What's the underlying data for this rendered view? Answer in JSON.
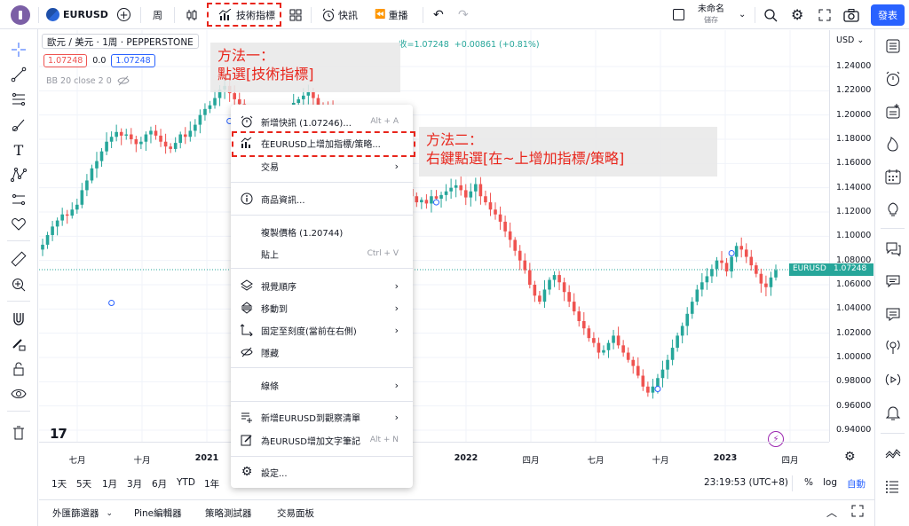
{
  "topbar": {
    "symbol": "EURUSD",
    "interval": "周",
    "indicators_label": "技術指標",
    "alert_label": "快訊",
    "replay_label": "重播",
    "layout_name": "未命名",
    "layout_sub": "儲存",
    "publish_label": "發表"
  },
  "legend": {
    "title": "歐元 / 美元 · 1周 · PEPPERSTONE",
    "ohlc_tail": "收=1.07248",
    "change": "+0.00861 (+0.81%)",
    "bid": "1.07248",
    "spread": "0.0",
    "ask": "1.07248",
    "indicator": "BB 20 close 2 0"
  },
  "price_axis": {
    "currency": "USD",
    "ticks": [
      "1.24000",
      "1.22000",
      "1.20000",
      "1.18000",
      "1.16000",
      "1.14000",
      "1.12000",
      "1.10000",
      "1.08000",
      "1.06000",
      "1.04000",
      "1.02000",
      "1.00000",
      "0.98000",
      "0.96000",
      "0.94000"
    ],
    "last_symbol": "EURUSD",
    "last_price": "1.07248"
  },
  "time_axis": {
    "ticks": [
      "七月",
      "十月",
      "2021",
      "2022",
      "四月",
      "七月",
      "十月",
      "2023",
      "四月"
    ]
  },
  "chart_data": {
    "type": "candlestick",
    "title": "歐元 / 美元 · 1周 · PEPPERSTONE",
    "ylim": [
      0.93,
      1.25
    ],
    "series_name": "EURUSD",
    "last": 1.07248,
    "close_path": [
      1.093,
      1.101,
      1.108,
      1.113,
      1.118,
      1.117,
      1.122,
      1.126,
      1.138,
      1.146,
      1.156,
      1.162,
      1.17,
      1.178,
      1.182,
      1.186,
      1.183,
      1.184,
      1.18,
      1.176,
      1.178,
      1.184,
      1.187,
      1.183,
      1.178,
      1.174,
      1.172,
      1.177,
      1.184,
      1.182,
      1.187,
      1.192,
      1.2,
      1.205,
      1.208,
      1.214,
      1.221,
      1.224,
      1.218,
      1.213,
      1.209,
      1.205,
      1.198,
      1.193,
      1.184,
      1.178,
      1.172,
      1.178,
      1.186,
      1.196,
      1.204,
      1.21,
      1.213,
      1.216,
      1.219,
      1.214,
      1.208,
      1.206,
      1.205,
      1.198,
      1.192,
      1.188,
      1.185,
      1.183,
      1.18,
      1.178,
      1.175,
      1.171,
      1.165,
      1.16,
      1.158,
      1.155,
      1.15,
      1.146,
      1.139,
      1.133,
      1.128,
      1.13,
      1.127,
      1.133,
      1.131,
      1.134,
      1.137,
      1.14,
      1.142,
      1.138,
      1.132,
      1.137,
      1.143,
      1.133,
      1.128,
      1.122,
      1.118,
      1.112,
      1.104,
      1.097,
      1.088,
      1.08,
      1.072,
      1.06,
      1.051,
      1.046,
      1.056,
      1.064,
      1.068,
      1.062,
      1.054,
      1.046,
      1.038,
      1.03,
      1.024,
      1.016,
      1.012,
      1.004,
      1.006,
      1.012,
      1.018,
      1.01,
      1.004,
      0.998,
      0.993,
      0.985,
      0.976,
      0.971,
      0.976,
      0.983,
      0.99,
      0.998,
      1.008,
      1.018,
      1.026,
      1.036,
      1.046,
      1.056,
      1.062,
      1.067,
      1.073,
      1.08,
      1.078,
      1.071,
      1.083,
      1.092,
      1.089,
      1.083,
      1.076,
      1.069,
      1.061,
      1.058,
      1.066,
      1.072
    ]
  },
  "annotations": {
    "method1_line1": "方法一：",
    "method1_line2": "點選[技術指標]",
    "method2_line1": "方法二：",
    "method2_line2": "右鍵點選[在~上增加指標/策略]"
  },
  "context_menu": {
    "add_alert": "新增快訊 (1.07246)...",
    "add_alert_sc": "Alt + A",
    "add_indicator": "在EURUSD上增加指標/策略...",
    "trade": "交易",
    "symbol_info": "商品資訊...",
    "copy_price": "複製價格 (1.20744)",
    "paste": "貼上",
    "paste_sc": "Ctrl + V",
    "visual_order": "視覺順序",
    "move_to": "移動到",
    "pin_scale": "固定至刻度(當前在右側)",
    "hide": "隱藏",
    "lines": "線條",
    "add_watchlist": "新增EURUSD到觀察清單",
    "add_note": "為EURUSD增加文字筆記",
    "add_note_sc": "Alt + N",
    "settings": "設定..."
  },
  "timeframes": {
    "items": [
      "1天",
      "5天",
      "1月",
      "3月",
      "6月",
      "YTD",
      "1年"
    ],
    "clock": "23:19:53 (UTC+8)",
    "percent": "%",
    "log": "log",
    "auto": "自動"
  },
  "bottom_tabs": [
    "外匯篩選器",
    "Pine編輯器",
    "策略測試器",
    "交易面板"
  ],
  "colors": {
    "up": "#26a69a",
    "down": "#ef5350",
    "accent": "#2962ff",
    "annotation": "#e8251b"
  }
}
